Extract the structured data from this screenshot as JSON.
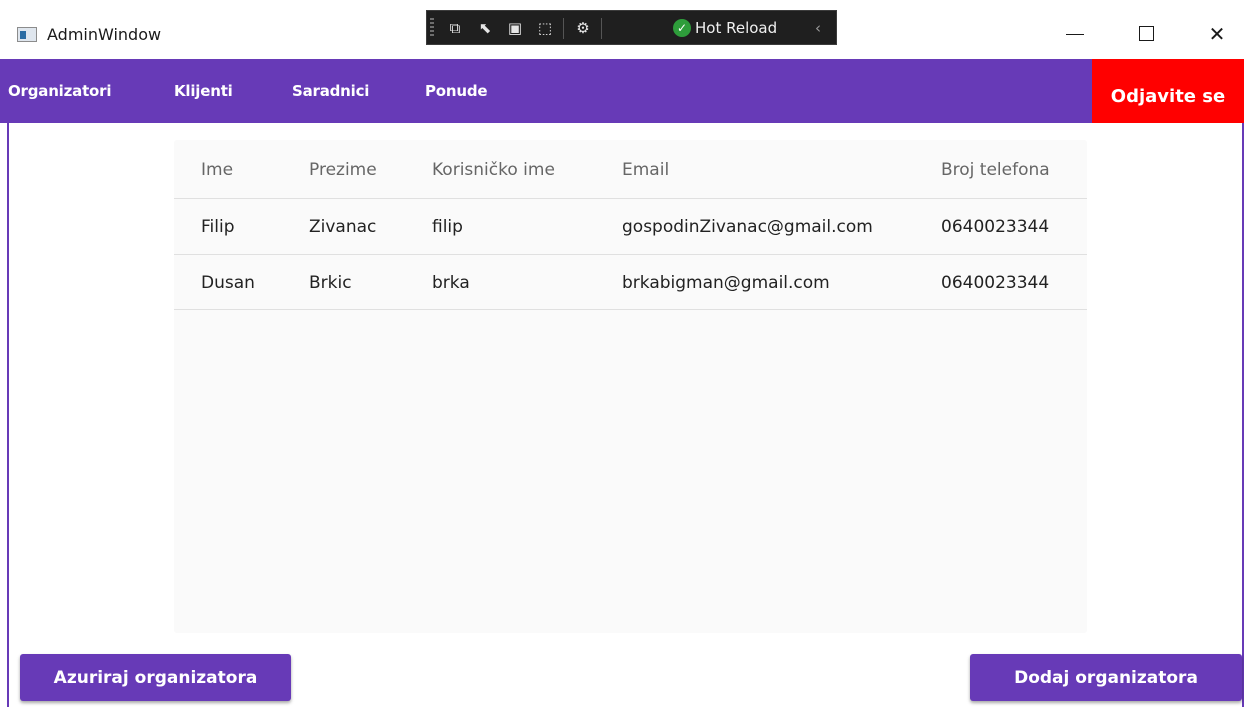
{
  "window": {
    "title": "AdminWindow",
    "hot_reload_label": "Hot Reload"
  },
  "nav": {
    "items": [
      "Organizatori",
      "Klijenti",
      "Saradnici",
      "Ponude"
    ],
    "logout_label": "Odjavite se"
  },
  "table": {
    "columns": [
      "Ime",
      "Prezime",
      "Korisničko ime",
      "Email",
      "Broj telefona"
    ],
    "rows": [
      [
        "Filip",
        "Zivanac",
        "filip",
        "gospodinZivanac@gmail.com",
        "0640023344"
      ],
      [
        "Dusan",
        "Brkic",
        "brka",
        "brkabigman@gmail.com",
        "0640023344"
      ]
    ]
  },
  "actions": {
    "update_label": "Azuriraj organizatora",
    "add_label": "Dodaj organizatora"
  },
  "colors": {
    "accent": "#673ab7",
    "logout": "#ff0000"
  }
}
